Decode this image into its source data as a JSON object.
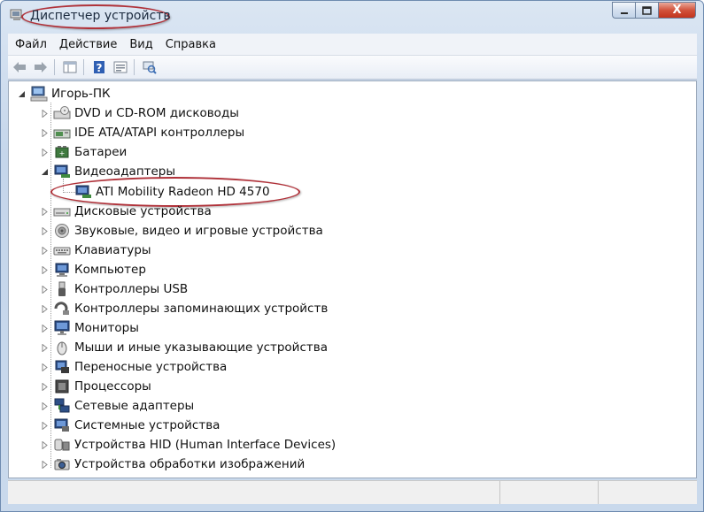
{
  "window": {
    "title": "Диспетчер устройств",
    "controls": {
      "minimize": "▁",
      "maximize": "▢",
      "close": "X"
    }
  },
  "menu": [
    "Файл",
    "Действие",
    "Вид",
    "Справка"
  ],
  "toolbar": {
    "buttons": [
      "back-icon",
      "forward-icon",
      "properties-icon",
      "help-icon",
      "console-tree-icon",
      "scan-hardware-icon"
    ]
  },
  "tree": {
    "root": {
      "label": "Игорь-ПК",
      "icon": "computer-icon",
      "expanded": true
    },
    "items": [
      {
        "label": "DVD и CD-ROM дисководы",
        "icon": "dvd-drive-icon",
        "expanded": false
      },
      {
        "label": "IDE ATA/ATAPI контроллеры",
        "icon": "ide-controller-icon",
        "expanded": false
      },
      {
        "label": "Батареи",
        "icon": "battery-icon",
        "expanded": false
      },
      {
        "label": "Видеоадаптеры",
        "icon": "display-adapter-icon",
        "expanded": true,
        "children": [
          {
            "label": "ATI Mobility Radeon HD 4570",
            "icon": "display-adapter-icon"
          }
        ]
      },
      {
        "label": "Дисковые устройства",
        "icon": "disk-drive-icon",
        "expanded": false
      },
      {
        "label": "Звуковые, видео и игровые устройства",
        "icon": "sound-icon",
        "expanded": false
      },
      {
        "label": "Клавиатуры",
        "icon": "keyboard-icon",
        "expanded": false
      },
      {
        "label": "Компьютер",
        "icon": "computer-icon",
        "expanded": false
      },
      {
        "label": "Контроллеры USB",
        "icon": "usb-icon",
        "expanded": false
      },
      {
        "label": "Контроллеры запоминающих устройств",
        "icon": "storage-controller-icon",
        "expanded": false
      },
      {
        "label": "Мониторы",
        "icon": "monitor-icon",
        "expanded": false
      },
      {
        "label": "Мыши и иные указывающие устройства",
        "icon": "mouse-icon",
        "expanded": false
      },
      {
        "label": "Переносные устройства",
        "icon": "portable-device-icon",
        "expanded": false
      },
      {
        "label": "Процессоры",
        "icon": "processor-icon",
        "expanded": false
      },
      {
        "label": "Сетевые адаптеры",
        "icon": "network-adapter-icon",
        "expanded": false
      },
      {
        "label": "Системные устройства",
        "icon": "system-device-icon",
        "expanded": false
      },
      {
        "label": "Устройства HID (Human Interface Devices)",
        "icon": "hid-icon",
        "expanded": false
      },
      {
        "label": "Устройства обработки изображений",
        "icon": "imaging-device-icon",
        "expanded": false
      }
    ]
  },
  "colors": {
    "highlight_ellipse": "#b0323a",
    "window_frame": "#c5d6eb"
  }
}
